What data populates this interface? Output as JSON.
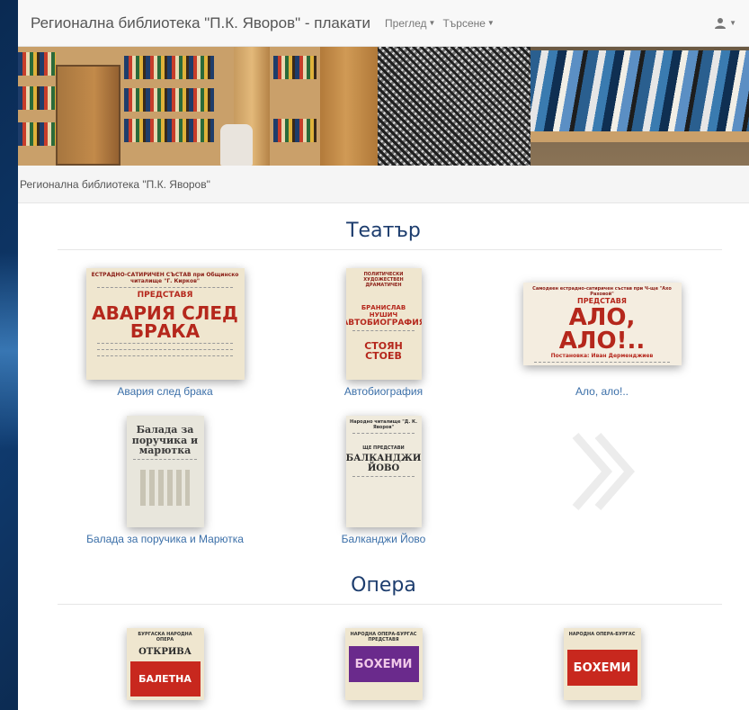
{
  "navbar": {
    "brand": "Регионална библиотека \"П.К. Яворов\" - плакати",
    "menus": [
      {
        "label": "Преглед"
      },
      {
        "label": "Търсене"
      }
    ],
    "user_icon": "user-icon"
  },
  "breadcrumb": {
    "label": "Регионална библиотека \"П.К. Яворов\""
  },
  "sections": [
    {
      "title": "Театър",
      "items": [
        {
          "caption": "Авария след брака",
          "poster": {
            "top": "ЕСТРАДНО-САТИРИЧЕН СЪСТАВ при Общинско читалище \"Г. Кирков\"",
            "mid": "ПРЕДСТАВЯ",
            "big": "АВАРИЯ СЛЕД БРАКА"
          }
        },
        {
          "caption": "Автобиография",
          "poster": {
            "top": "ПОЛИТИЧЕСКИ ХУДОЖЕСТВЕН ДРАМАТИЧЕН",
            "mid": "БРАНИСЛАВ НУШИЧ",
            "big": "АВТОБИОГРАФИЯ",
            "bottom": "СТОЯН СТОЕВ"
          }
        },
        {
          "caption": "Ало, ало!..",
          "poster": {
            "top": "Самодеен естрадно-сатиричен състав при Ч-ще \"Ахо Раховой\"",
            "mid": "ПРЕДСТАВЯ",
            "big": "АЛО, АЛО!..",
            "bottom": "Постановка: Иван Дерменджиев"
          }
        },
        {
          "caption": "Балада за поручика и Марютка",
          "poster": {
            "big": "Балада за поручика и марютка"
          }
        },
        {
          "caption": "Балканджи Йово",
          "poster": {
            "top": "Народно читалище \"Д. К. Яворов\"",
            "mid": "ЩЕ ПРЕДСТАВИ",
            "big": "БАЛКАНДЖИ ЙОВО"
          }
        }
      ]
    },
    {
      "title": "Опера",
      "items": [
        {
          "poster": {
            "top": "БУРГАСКА НАРОДНА ОПЕРА",
            "mid": "ОТКРИВА",
            "big": "БАЛЕТНА"
          }
        },
        {
          "poster": {
            "top": "НАРОДНА ОПЕРА-БУРГАС",
            "mid": "ПРЕДСТАВЯ",
            "big": "БОХЕМИ"
          }
        },
        {
          "poster": {
            "top": "НАРОДНА ОПЕРА-БУРГАС",
            "big": "БОХЕМИ"
          }
        }
      ]
    }
  ],
  "colors": {
    "title": "#1d3d6e",
    "link": "#3b6fa8",
    "opera_purple": "#6a2a8c",
    "opera_red": "#c8281e"
  }
}
